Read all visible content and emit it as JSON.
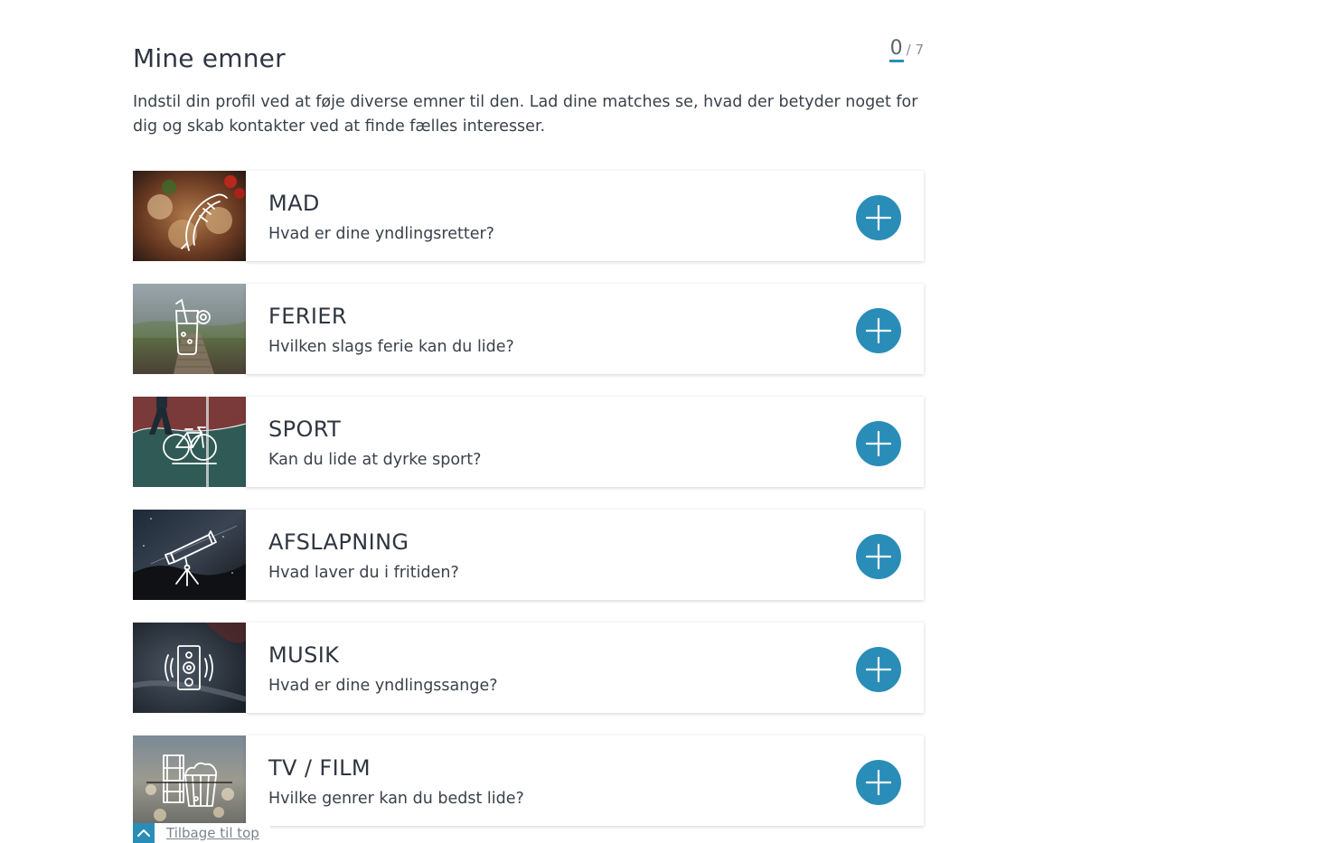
{
  "section": {
    "title": "Mine emner",
    "counter_current": "0",
    "counter_total": "/ 7",
    "description": "Indstil din profil ved at føje diverse emner til den. Lad dine matches se, hvad der betyder noget for dig og skab kontakter ved at finde fælles interesser."
  },
  "topics": [
    {
      "name": "MAD",
      "question": "Hvad er dine yndlingsretter?",
      "icon": "shrimp-food-icon"
    },
    {
      "name": "FERIER",
      "question": "Hvilken slags ferie kan du lide?",
      "icon": "cocktail-drink-icon"
    },
    {
      "name": "SPORT",
      "question": "Kan du lide at dyrke sport?",
      "icon": "bicycle-icon"
    },
    {
      "name": "AFSLAPNING",
      "question": "Hvad laver du i fritiden?",
      "icon": "telescope-icon"
    },
    {
      "name": "MUSIK",
      "question": "Hvad er dine yndlingssange?",
      "icon": "speaker-icon"
    },
    {
      "name": "TV / FILM",
      "question": "Hvilke genrer kan du bedst lide?",
      "icon": "film-popcorn-icon"
    }
  ],
  "footer": {
    "back_to_top": "Tilbage til top"
  },
  "colors": {
    "accent": "#2a8db8",
    "text": "#2f3640"
  }
}
